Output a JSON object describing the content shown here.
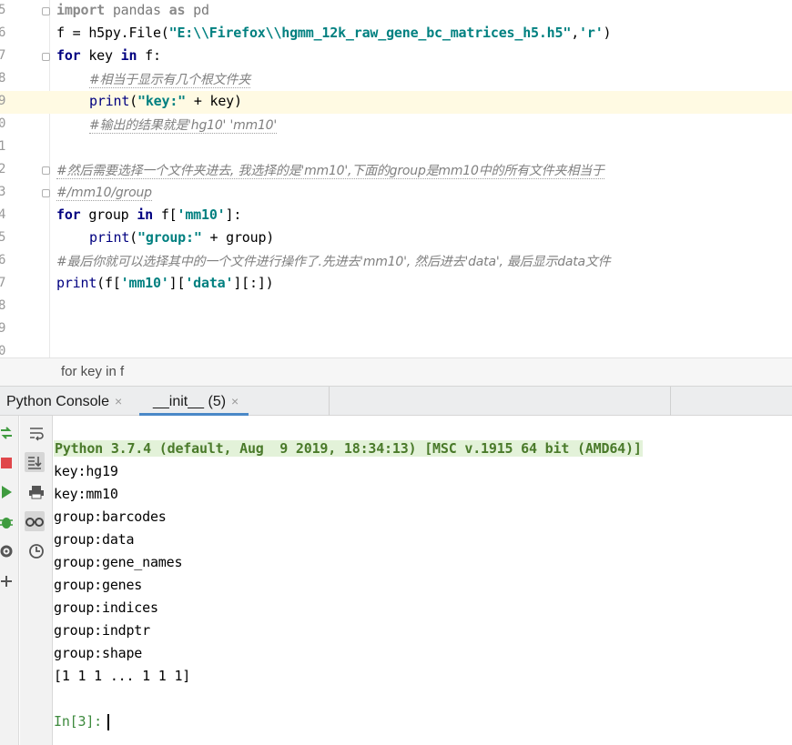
{
  "editor": {
    "lines": [
      {
        "num": "5"
      },
      {
        "num": "6"
      },
      {
        "num": "7"
      },
      {
        "num": "8"
      },
      {
        "num": "9"
      },
      {
        "num": "0"
      },
      {
        "num": "1"
      },
      {
        "num": "2"
      },
      {
        "num": "3"
      },
      {
        "num": "4"
      },
      {
        "num": "5"
      },
      {
        "num": "6"
      },
      {
        "num": "7"
      },
      {
        "num": "8"
      },
      {
        "num": "9"
      },
      {
        "num": "0"
      }
    ],
    "tokens": {
      "l5_a": "import",
      "l5_b": " pandas ",
      "l5_c": "as",
      "l5_d": " pd",
      "l6_a": "f = h5py.File(",
      "l6_b": "\"E:\\\\Firefox\\\\hgmm_12k_raw_gene_bc_matrices_h5.h5\"",
      "l6_c": ",",
      "l6_d": "'r'",
      "l6_e": ")",
      "l7_a": "for",
      "l7_b": " key ",
      "l7_c": "in",
      "l7_d": " f:",
      "l8": "#相当于显示有几个根文件夹",
      "l9_a": "print",
      "l9_b": "(",
      "l9_c": "\"key:\"",
      "l9_d": " + key)",
      "l10": "#输出的结果就是'hg10' 'mm10'",
      "l12": "#然后需要选择一个文件夹进去, 我选择的是'mm10',下面的group是mm10中的所有文件夹相当于",
      "l13": "#/mm10/group",
      "l14_a": "for",
      "l14_b": " group ",
      "l14_c": "in",
      "l14_d": " f[",
      "l14_e": "'mm10'",
      "l14_f": "]:",
      "l15_a": "print",
      "l15_b": "(",
      "l15_c": "\"group:\"",
      "l15_d": " + group)",
      "l16": "#最后你就可以选择其中的一个文件进行操作了.先进去'mm10', 然后进去'data', 最后显示data文件",
      "l17_a": "print",
      "l17_b": "(f[",
      "l17_c": "'mm10'",
      "l17_d": "][",
      "l17_e": "'data'",
      "l17_f": "][:])"
    }
  },
  "breadcrumb": {
    "text": "for key in f"
  },
  "tabs": [
    {
      "label": "Python Console",
      "close": "×"
    },
    {
      "label": "__init__ (5)",
      "close": "×"
    }
  ],
  "console": {
    "banner": "Python 3.7.4 (default, Aug  9 2019, 18:34:13) [MSC v.1915 64 bit (AMD64)]",
    "output": [
      "key:hg19",
      "key:mm10",
      "group:barcodes",
      "group:data",
      "group:gene_names",
      "group:genes",
      "group:indices",
      "group:indptr",
      "group:shape",
      "[1 1 1 ... 1 1 1]"
    ],
    "prompt": "In[3]:"
  },
  "icons": {
    "left": [
      "rerun-icon",
      "stop-icon",
      "run-icon",
      "debug-icon",
      "settings-icon",
      "add-icon"
    ],
    "tools": [
      "soft-wrap-icon",
      "scroll-to-end-icon",
      "print-icon",
      "show-variables-icon",
      "history-icon"
    ]
  },
  "colors": {
    "keyword": "#000080",
    "string": "#008080",
    "comment": "#808080",
    "banner_bg": "#e3f2d9",
    "tab_underline": "#4a88c7"
  }
}
